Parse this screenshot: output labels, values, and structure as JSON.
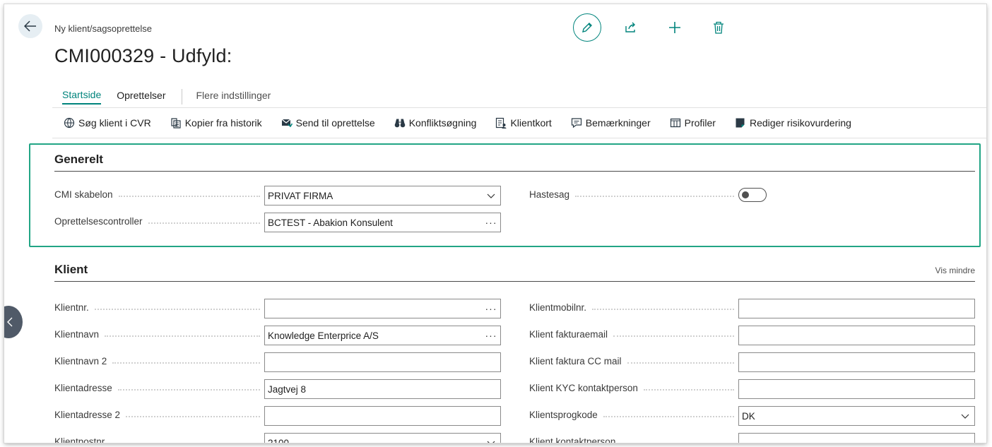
{
  "header": {
    "breadcrumb": "Ny klient/sagsoprettelse",
    "title": "CMI000329 - Udfyld:"
  },
  "tabs": [
    {
      "label": "Startside",
      "active": true
    },
    {
      "label": "Oprettelser",
      "active": false
    },
    {
      "label": "Flere indstillinger",
      "active": false
    }
  ],
  "toolbar": [
    {
      "label": "Søg klient i CVR",
      "icon": "globe-icon"
    },
    {
      "label": "Kopier fra historik",
      "icon": "copy-icon"
    },
    {
      "label": "Send til oprettelse",
      "icon": "send-mail-icon"
    },
    {
      "label": "Konfliktsøgning",
      "icon": "binoculars-icon"
    },
    {
      "label": "Klientkort",
      "icon": "contact-card-icon"
    },
    {
      "label": "Bemærkninger",
      "icon": "comment-icon"
    },
    {
      "label": "Profiler",
      "icon": "columns-icon"
    },
    {
      "label": "Rediger risikovurdering",
      "icon": "edit-document-icon"
    }
  ],
  "generelt": {
    "title": "Generelt",
    "cmi_skabelon": {
      "label": "CMI skabelon",
      "value": "PRIVAT FIRMA"
    },
    "controller": {
      "label": "Oprettelsescontroller",
      "value": "BCTEST - Abakion Konsulent"
    },
    "hastesag": {
      "label": "Hastesag",
      "value": false
    }
  },
  "klient": {
    "title": "Klient",
    "toggle_label": "Vis mindre",
    "left": [
      {
        "label": "Klientnr.",
        "value": "",
        "suffix": "···"
      },
      {
        "label": "Klientnavn",
        "value": "Knowledge Enterprice A/S",
        "suffix": "···"
      },
      {
        "label": "Klientnavn 2",
        "value": ""
      },
      {
        "label": "Klientadresse",
        "value": "Jagtvej 8"
      },
      {
        "label": "Klientadresse 2",
        "value": ""
      },
      {
        "label": "Klientpostnr.",
        "value": "2100",
        "suffix": "chevron"
      }
    ],
    "right": [
      {
        "label": "Klientmobilnr.",
        "value": ""
      },
      {
        "label": "Klient fakturaemail",
        "value": ""
      },
      {
        "label": "Klient faktura CC mail",
        "value": ""
      },
      {
        "label": "Klient KYC kontaktperson",
        "value": ""
      },
      {
        "label": "Klientsprogkode",
        "value": "DK",
        "suffix": "chevron"
      },
      {
        "label": "Klient kontaktperson",
        "value": "",
        "suffix": "···"
      }
    ]
  },
  "colors": {
    "accent": "#00847c",
    "highlight": "#22a585"
  }
}
